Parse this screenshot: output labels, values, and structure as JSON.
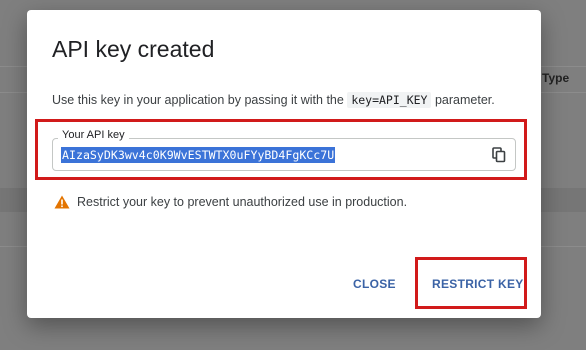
{
  "background": {
    "column_header": "Type"
  },
  "dialog": {
    "title": "API key created",
    "description_prefix": "Use this key in your application by passing it with the",
    "description_code": "key=API_KEY",
    "description_suffix": "parameter.",
    "key_label": "Your API key",
    "key_value": "AIzaSyDK3wv4c0K9WvESTWTX0uFYyBD4FgKCc7U",
    "copy_icon": "copy-icon",
    "warning_icon": "warning-icon",
    "warning_text": "Restrict your key to prevent unauthorized use in production.",
    "close_label": "CLOSE",
    "restrict_label": "RESTRICT KEY"
  },
  "colors": {
    "highlight_outline": "#d11a1a",
    "selection": "#3b73d8",
    "warning": "#e37400",
    "button_text": "#3b63a6"
  }
}
